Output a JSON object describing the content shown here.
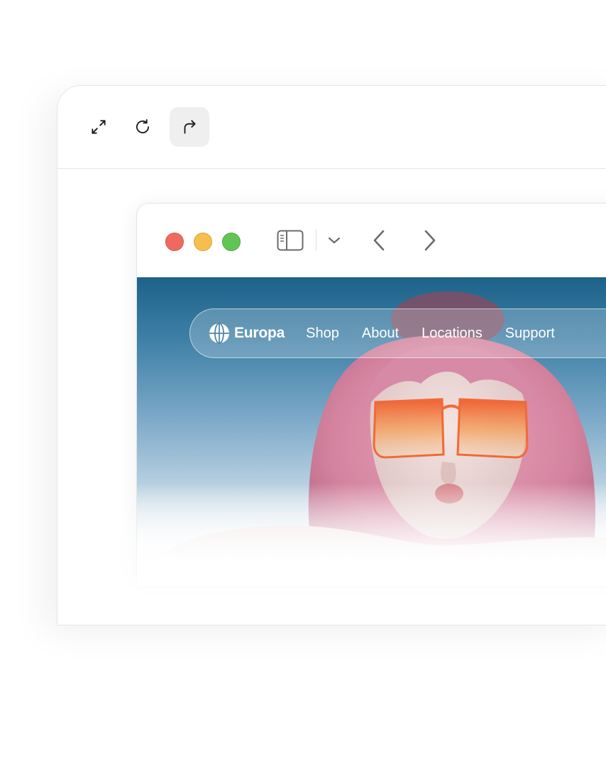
{
  "toolbar": {
    "buttons": [
      {
        "icon": "expand-icon"
      },
      {
        "icon": "reload-icon"
      },
      {
        "icon": "redo-icon",
        "active": true
      }
    ]
  },
  "browser": {
    "traffic_lights": {
      "close": "#ee6a5e",
      "minimize": "#f5bf4f",
      "maximize": "#61c554"
    },
    "controls": [
      "sidebar-icon",
      "chevron-down-icon",
      "back-arrow-icon",
      "forward-arrow-icon"
    ]
  },
  "site": {
    "brand": "Europa",
    "nav": [
      "Shop",
      "About",
      "Locations",
      "Support"
    ]
  },
  "colors": {
    "sky_top": "#1d6289",
    "hair": "#d98aa8",
    "glasses": "#f07a3a",
    "active_button_bg": "#efefef"
  }
}
